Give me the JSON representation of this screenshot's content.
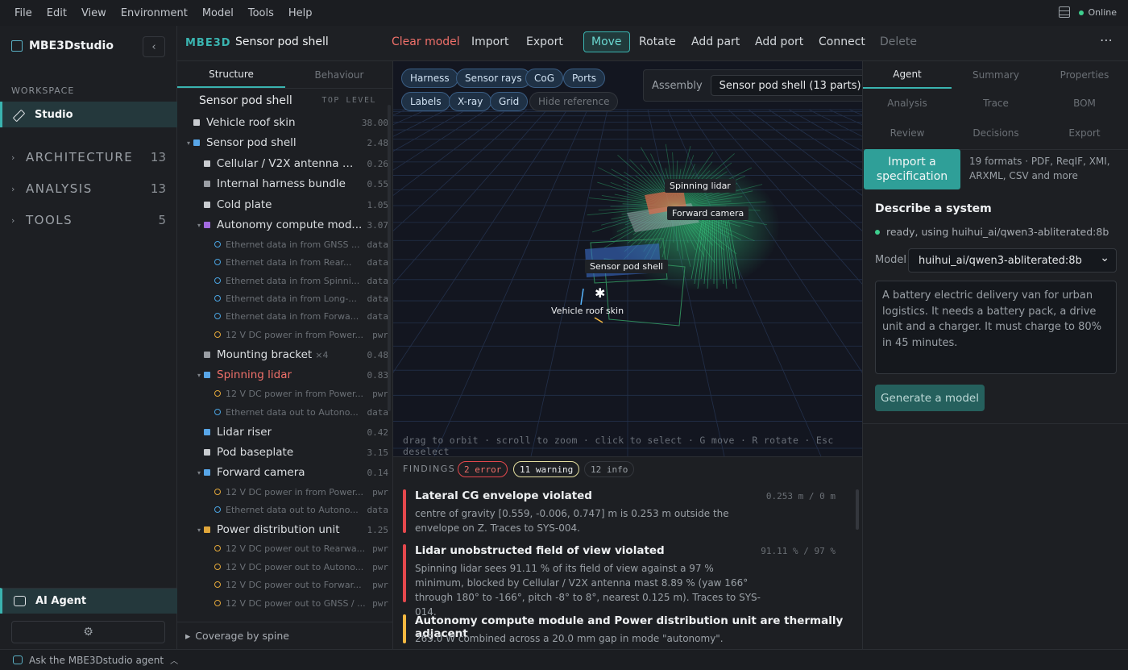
{
  "menu": [
    "File",
    "Edit",
    "View",
    "Environment",
    "Model",
    "Tools",
    "Help"
  ],
  "status": "Online",
  "sidebar": {
    "app_name": "MBE3Dstudio",
    "workspace_label": "WORKSPACE",
    "studio_label": "Studio",
    "groups": [
      {
        "label": "ARCHITECTURE",
        "count": "13"
      },
      {
        "label": "ANALYSIS",
        "count": "13"
      },
      {
        "label": "TOOLS",
        "count": "5"
      }
    ],
    "agent_label": "AI Agent"
  },
  "bottombar": {
    "ask": "Ask the MBE3Dstudio agent"
  },
  "toolbar": {
    "tag": "MBE3D",
    "doc_title": "Sensor pod shell",
    "clear": "Clear model",
    "import": "Import",
    "export": "Export",
    "move": "Move",
    "rotate": "Rotate",
    "add_part": "Add part",
    "add_port": "Add port",
    "connect": "Connect",
    "delete": "Delete"
  },
  "structure": {
    "tabs": [
      "Structure",
      "Behaviour"
    ],
    "root": "Sensor pod shell",
    "root_note": "TOP LEVEL",
    "rows": [
      {
        "label": "Vehicle roof skin",
        "value": "38.00"
      },
      {
        "label": "Sensor pod shell",
        "value": "2.48"
      },
      {
        "label": "Cellular / V2X antenna m...",
        "value": "0.26"
      },
      {
        "label": "Internal harness bundle",
        "value": "0.55"
      },
      {
        "label": "Cold plate",
        "value": "1.05"
      },
      {
        "label": "Autonomy compute mod...",
        "value": "3.07"
      },
      {
        "label": "Ethernet data in from GNSS ...",
        "value": "data"
      },
      {
        "label": "Ethernet data in from Rear...",
        "value": "data"
      },
      {
        "label": "Ethernet data in from Spinni...",
        "value": "data"
      },
      {
        "label": "Ethernet data in from Long-...",
        "value": "data"
      },
      {
        "label": "Ethernet data in from Forwa...",
        "value": "data"
      },
      {
        "label": "12 V DC power in from Power...",
        "value": "pwr"
      },
      {
        "label": "Mounting bracket",
        "qty": "×4",
        "value": "0.48"
      },
      {
        "label": "Spinning lidar",
        "value": "0.83"
      },
      {
        "label": "12 V DC power in from Power...",
        "value": "pwr"
      },
      {
        "label": "Ethernet data out to Autono...",
        "value": "data"
      },
      {
        "label": "Lidar riser",
        "value": "0.42"
      },
      {
        "label": "Pod baseplate",
        "value": "3.15"
      },
      {
        "label": "Forward camera",
        "value": "0.14"
      },
      {
        "label": "12 V DC power in from Power...",
        "value": "pwr"
      },
      {
        "label": "Ethernet data out to Autono...",
        "value": "data"
      },
      {
        "label": "Power distribution unit",
        "value": "1.25"
      },
      {
        "label": "12 V DC power out to Rearwa...",
        "value": "pwr"
      },
      {
        "label": "12 V DC power out to Autono...",
        "value": "pwr"
      },
      {
        "label": "12 V DC power out to Forwar...",
        "value": "pwr"
      },
      {
        "label": "12 V DC power out to GNSS / ...",
        "value": "pwr"
      }
    ],
    "coverage": "Coverage by spine"
  },
  "viewport": {
    "chips": [
      "Harness",
      "Sensor rays",
      "CoG",
      "Ports",
      "Labels",
      "X-ray",
      "Grid",
      "Hide reference"
    ],
    "assembly_label": "Assembly",
    "assembly_value": "Sensor pod shell (13 parts)",
    "labels": {
      "lidar": "Spinning lidar",
      "camera": "Forward camera",
      "shell": "Sensor pod shell",
      "roof": "Vehicle roof skin"
    },
    "hint": "drag to orbit · scroll to zoom · click to select · G move · R rotate · Esc deselect"
  },
  "findings": {
    "title": "FINDINGS",
    "errors": "2 error",
    "warnings": "11 warning",
    "infos": "12 info",
    "items": [
      {
        "title": "Lateral CG envelope violated",
        "value": "0.253 m / 0 m",
        "desc": "centre of gravity [0.559, -0.006, 0.747] m is 0.253 m outside the envelope on Z. Traces to SYS-004."
      },
      {
        "title": "Lidar unobstructed field of view violated",
        "value": "91.11 % / 97 %",
        "desc": "Spinning lidar sees 91.11 % of its field of view against a 97 % minimum, blocked by Cellular / V2X antenna mast 8.89 % (yaw 166° through 180° to -166°, pitch -8° to 8°, nearest 0.125 m). Traces to SYS-014."
      },
      {
        "title": "Autonomy compute module and Power distribution unit are thermally adjacent",
        "value": "",
        "desc": "265.0 W combined across a 20.0 mm gap in mode \"autonomy\"."
      }
    ],
    "colors": {
      "error": "#e5484d",
      "warning": "#f5b841"
    }
  },
  "agent": {
    "tabs": [
      "Agent",
      "Summary",
      "Properties",
      "Analysis",
      "Trace",
      "BOM",
      "Review",
      "Decisions",
      "Export"
    ],
    "import_btn": "Import a specification",
    "import_note": "19 formats · PDF, ReqIF, XMI, ARXML, CSV and more",
    "describe": "Describe a system",
    "ready": "ready, using huihui_ai/qwen3-abliterated:8b",
    "model_label": "Model",
    "model_value": "huihui_ai/qwen3-abliterated:8b",
    "prompt": "A battery electric delivery van for urban logistics. It needs a battery pack, a drive unit and a charger. It must charge to 80% in 45 minutes.",
    "generate": "Generate a model"
  }
}
